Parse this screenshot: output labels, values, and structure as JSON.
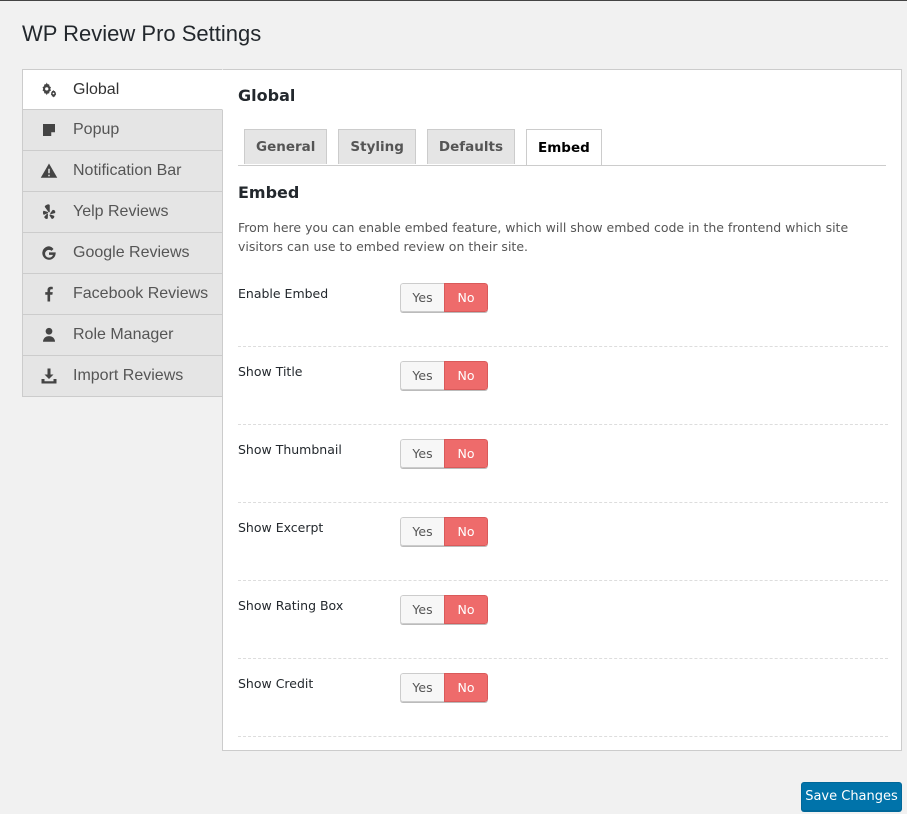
{
  "page": {
    "title": "WP Review Pro Settings"
  },
  "sidebar": {
    "items": [
      {
        "label": "Global",
        "icon": "gears-icon",
        "active": true
      },
      {
        "label": "Popup",
        "icon": "sticky-note-icon"
      },
      {
        "label": "Notification Bar",
        "icon": "warning-icon"
      },
      {
        "label": "Yelp Reviews",
        "icon": "yelp-icon"
      },
      {
        "label": "Google Reviews",
        "icon": "google-icon"
      },
      {
        "label": "Facebook Reviews",
        "icon": "facebook-icon"
      },
      {
        "label": "Role Manager",
        "icon": "user-icon"
      },
      {
        "label": "Import Reviews",
        "icon": "download-icon"
      }
    ]
  },
  "panel": {
    "title": "Global",
    "tabs": [
      {
        "label": "General"
      },
      {
        "label": "Styling"
      },
      {
        "label": "Defaults"
      },
      {
        "label": "Embed",
        "active": true
      }
    ],
    "section_title": "Embed",
    "description": "From here you can enable embed feature, which will show embed code in the frontend which site visitors can use to embed review on their site.",
    "rows": [
      {
        "label": "Enable Embed",
        "yes": "Yes",
        "no": "No",
        "value": "No"
      },
      {
        "label": "Show Title",
        "yes": "Yes",
        "no": "No",
        "value": "No"
      },
      {
        "label": "Show Thumbnail",
        "yes": "Yes",
        "no": "No",
        "value": "No"
      },
      {
        "label": "Show Excerpt",
        "yes": "Yes",
        "no": "No",
        "value": "No"
      },
      {
        "label": "Show Rating Box",
        "yes": "Yes",
        "no": "No",
        "value": "No"
      },
      {
        "label": "Show Credit",
        "yes": "Yes",
        "no": "No",
        "value": "No"
      }
    ]
  },
  "footer": {
    "save_label": "Save Changes"
  },
  "colors": {
    "toggle_no_active": "#ee6b6b",
    "primary_button": "#0073aa"
  }
}
